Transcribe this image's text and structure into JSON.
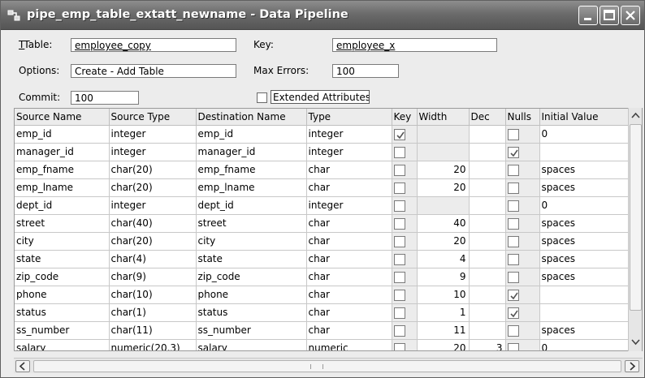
{
  "window": {
    "title": "pipe_emp_table_extatt_newname - Data Pipeline"
  },
  "form": {
    "table_label": "Table:",
    "table_value": "employee_copy",
    "key_label": "Key:",
    "key_value": "employee_x",
    "options_label": "Options:",
    "options_value": "Create - Add Table",
    "max_errors_label": "Max Errors:",
    "max_errors_value": "100",
    "commit_label": "Commit:",
    "commit_value": "100",
    "extended_attributes_label": "Extended Attributes",
    "extended_attributes_checked": false
  },
  "grid": {
    "columns": [
      "Source Name",
      "Source Type",
      "Destination Name",
      "Type",
      "Key",
      "Width",
      "Dec",
      "Nulls",
      "Initial Value"
    ],
    "rows": [
      {
        "source_name": "emp_id",
        "source_type": "integer",
        "dest_name": "emp_id",
        "type": "integer",
        "key": true,
        "width": "",
        "dec": "",
        "nulls": false,
        "initial": "0"
      },
      {
        "source_name": "manager_id",
        "source_type": "integer",
        "dest_name": "manager_id",
        "type": "integer",
        "key": false,
        "width": "",
        "dec": "",
        "nulls": true,
        "initial": ""
      },
      {
        "source_name": "emp_fname",
        "source_type": "char(20)",
        "dest_name": "emp_fname",
        "type": "char",
        "key": false,
        "width": "20",
        "dec": "",
        "nulls": false,
        "initial": "spaces"
      },
      {
        "source_name": "emp_lname",
        "source_type": "char(20)",
        "dest_name": "emp_lname",
        "type": "char",
        "key": false,
        "width": "20",
        "dec": "",
        "nulls": false,
        "initial": "spaces"
      },
      {
        "source_name": "dept_id",
        "source_type": "integer",
        "dest_name": "dept_id",
        "type": "integer",
        "key": false,
        "width": "",
        "dec": "",
        "nulls": false,
        "initial": "0"
      },
      {
        "source_name": "street",
        "source_type": "char(40)",
        "dest_name": "street",
        "type": "char",
        "key": false,
        "width": "40",
        "dec": "",
        "nulls": false,
        "initial": "spaces"
      },
      {
        "source_name": "city",
        "source_type": "char(20)",
        "dest_name": "city",
        "type": "char",
        "key": false,
        "width": "20",
        "dec": "",
        "nulls": false,
        "initial": "spaces"
      },
      {
        "source_name": "state",
        "source_type": "char(4)",
        "dest_name": "state",
        "type": "char",
        "key": false,
        "width": "4",
        "dec": "",
        "nulls": false,
        "initial": "spaces"
      },
      {
        "source_name": "zip_code",
        "source_type": "char(9)",
        "dest_name": "zip_code",
        "type": "char",
        "key": false,
        "width": "9",
        "dec": "",
        "nulls": false,
        "initial": "spaces"
      },
      {
        "source_name": "phone",
        "source_type": "char(10)",
        "dest_name": "phone",
        "type": "char",
        "key": false,
        "width": "10",
        "dec": "",
        "nulls": true,
        "initial": ""
      },
      {
        "source_name": "status",
        "source_type": "char(1)",
        "dest_name": "status",
        "type": "char",
        "key": false,
        "width": "1",
        "dec": "",
        "nulls": true,
        "initial": ""
      },
      {
        "source_name": "ss_number",
        "source_type": "char(11)",
        "dest_name": "ss_number",
        "type": "char",
        "key": false,
        "width": "11",
        "dec": "",
        "nulls": false,
        "initial": "spaces"
      },
      {
        "source_name": "salary",
        "source_type": "numeric(20,3)",
        "dest_name": "salary",
        "type": "numeric",
        "key": false,
        "width": "20",
        "dec": "3",
        "nulls": false,
        "initial": "0"
      }
    ]
  }
}
